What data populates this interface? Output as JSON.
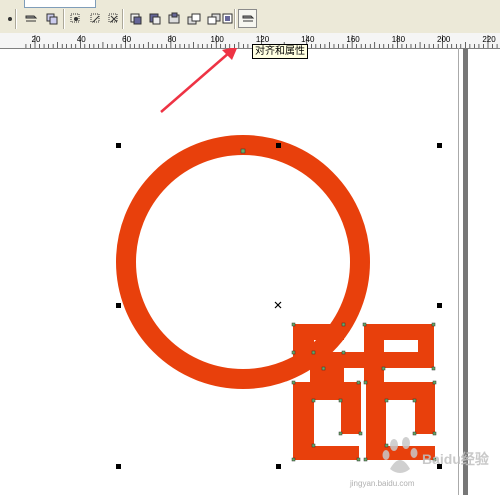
{
  "app": "CorelDRAW",
  "toolbar": {
    "buttons": [
      {
        "name": "align-to-object-icon"
      },
      {
        "name": "weld-icon"
      },
      {
        "name": "trim-icon"
      },
      {
        "name": "intersect-icon"
      },
      {
        "name": "simplify-icon"
      },
      {
        "name": "front-minus-back-icon"
      },
      {
        "name": "back-minus-front-icon"
      },
      {
        "name": "create-boundary-icon"
      },
      {
        "name": "to-front-icon"
      },
      {
        "name": "to-back-icon"
      },
      {
        "name": "align-and-distribute-icon"
      }
    ],
    "tooltip": "对齐和属性"
  },
  "ruler": {
    "labels": [
      "20",
      "40",
      "60",
      "80",
      "100",
      "120",
      "140",
      "160",
      "180",
      "200",
      "220"
    ]
  },
  "colors": {
    "shape": "#e8400c",
    "toolbar_bg": "#ece9d8",
    "arrow": "#ee3344"
  },
  "watermark": {
    "logo_text": "Baidu经验",
    "url": "jingyan.baidu.com"
  }
}
